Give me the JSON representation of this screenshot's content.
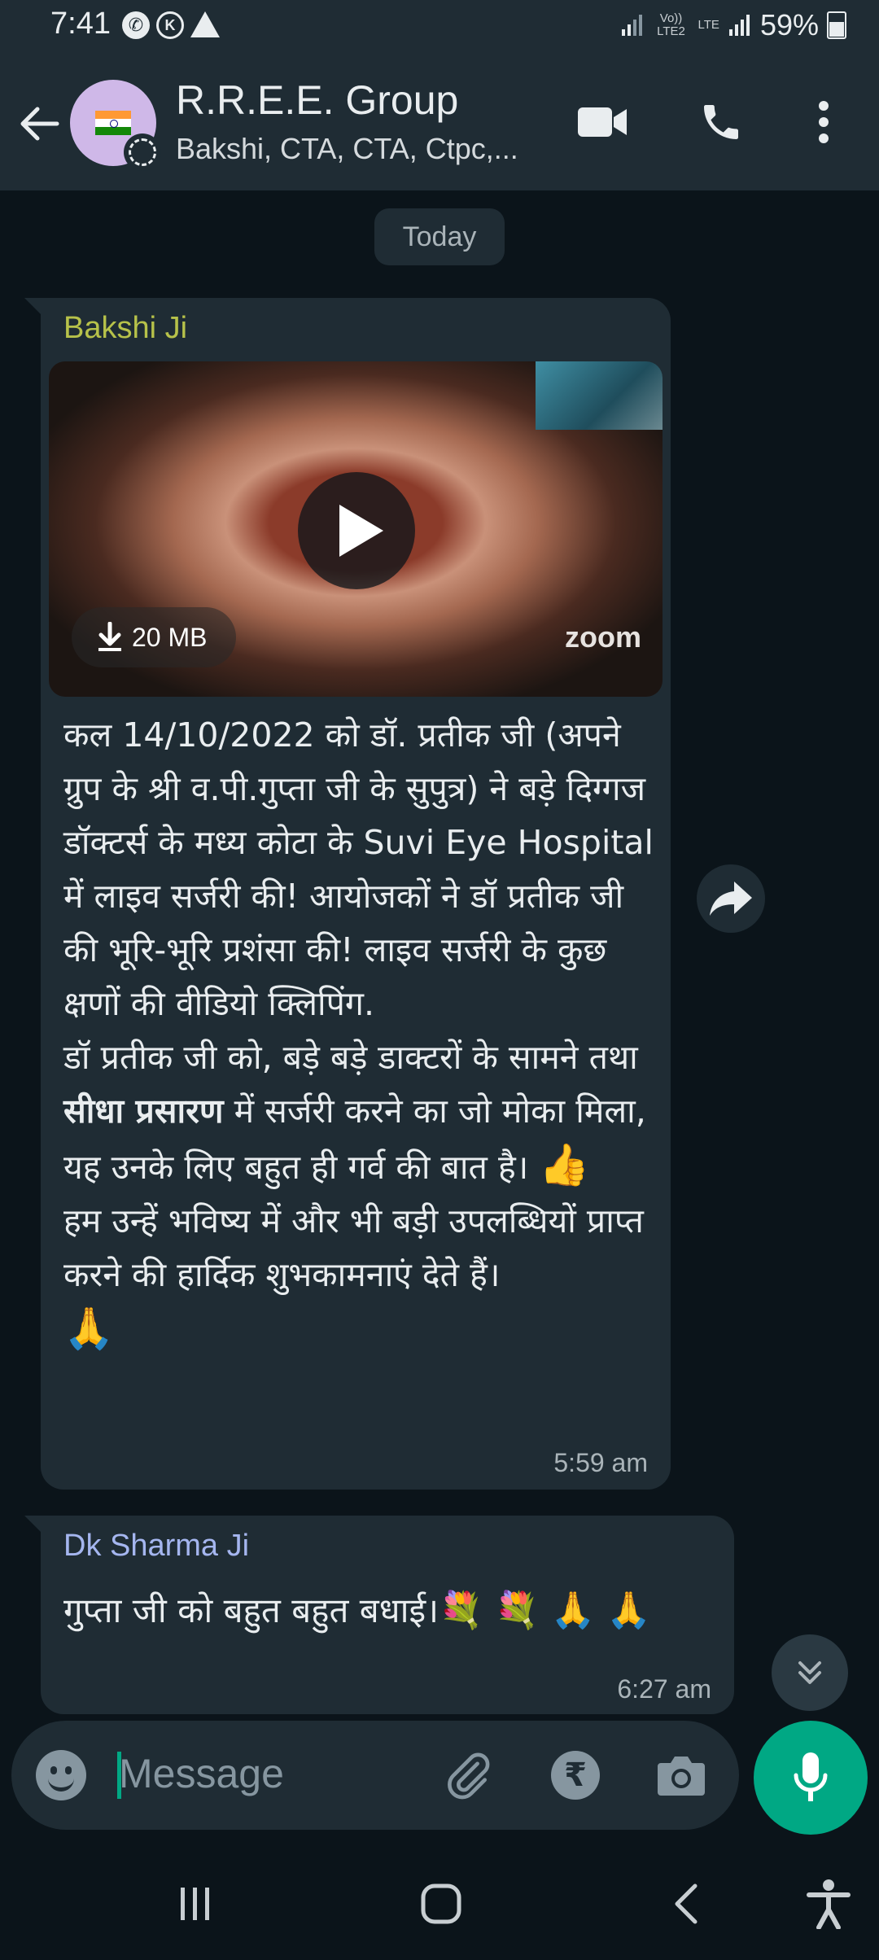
{
  "status_bar": {
    "time": "7:41",
    "circle_icon_1": "✆",
    "circle_icon_2": "K",
    "volte_label": "Vo)) LTE2",
    "lte_label": "LTE",
    "battery": "59%"
  },
  "header": {
    "title": "R.R.E.E. Group",
    "subtitle": "Bakshi, CTA, CTA, Ctpc,..."
  },
  "chat": {
    "date_chip": "Today",
    "messages": [
      {
        "sender": "Bakshi Ji",
        "sender_color": "#b7c24a",
        "video": {
          "size": "20 MB",
          "watermark": "zoom"
        },
        "paragraphs": [
          "कल 14/10/2022 को डॉ. प्रतीक जी (अपने ग्रुप के श्री व.पी.गुप्ता जी के सुपुत्र) ने बड़े दिग्गज डॉक्टर्स के मध्य कोटा के Suvi Eye Hospital में लाइव सर्जरी की! आयोजकों ने डॉ प्रतीक जी की भूरि-भूरि प्रशंसा की! लाइव सर्जरी के कुछ क्षणों की वीडियो क्लिपिंग."
        ],
        "p2_before_bold": "डॉ प्रतीक जी को, बड़े बड़े डाक्टरों के सामने तथा ",
        "p2_bold": "सीधा प्रसारण",
        "p2_after_bold": " में सर्जरी करने का जो मोका मिला, यह उनके लिए बहुत ही गर्व की बात है। ",
        "p2_emoji": "👍",
        "p3": "हम उन्हें भविष्य में और भी बड़ी उपलब्धियों प्राप्त करने की हार्दिक शुभकामनाएं देते हैं।",
        "p3_emoji": "🙏",
        "time": "5:59 am"
      },
      {
        "sender": "Dk Sharma Ji",
        "sender_color": "#a5b6ef",
        "text": "गुप्ता जी को बहुत बहुत बधाई।",
        "emojis": "💐 💐 🙏 🙏",
        "time": "6:27 am"
      }
    ]
  },
  "input": {
    "placeholder": "Message",
    "rupee_symbol": "₹"
  },
  "colors": {
    "accent": "#00a884",
    "bubble": "#1f2c34",
    "background": "#0b141a"
  },
  "icons": [
    "back-arrow-icon",
    "video-call-icon",
    "phone-icon",
    "more-vert-icon",
    "play-icon",
    "download-icon",
    "forward-icon",
    "scroll-down-icon",
    "emoji-icon",
    "attach-icon",
    "rupee-icon",
    "camera-icon",
    "mic-icon",
    "nav-recents-icon",
    "nav-home-icon",
    "nav-back-icon",
    "accessibility-icon"
  ]
}
